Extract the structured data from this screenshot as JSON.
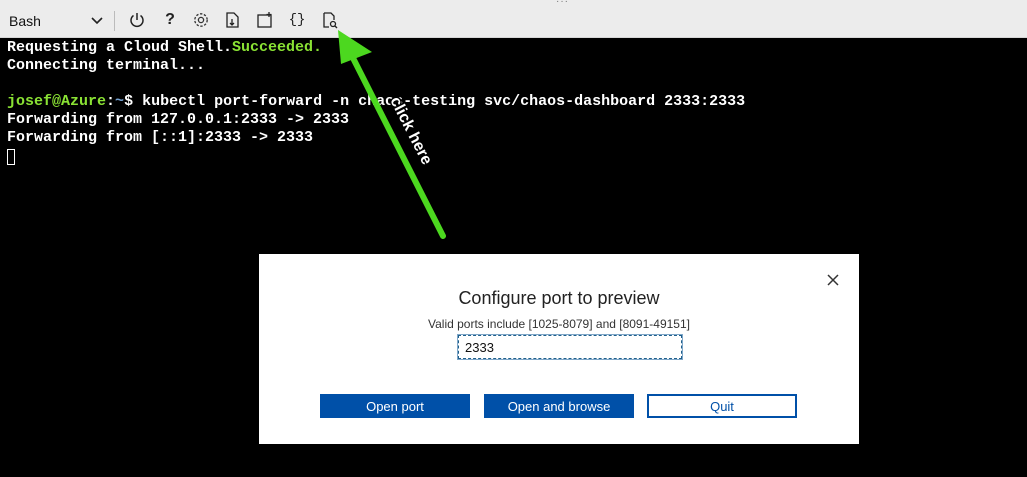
{
  "toolbar": {
    "shell_selector": {
      "value": "Bash"
    },
    "icons": [
      {
        "name": "restart-icon",
        "glyph": "⏻"
      },
      {
        "name": "help-icon",
        "glyph": "?"
      },
      {
        "name": "settings-icon",
        "glyph": "⚙"
      },
      {
        "name": "upload-download-icon",
        "glyph": ""
      },
      {
        "name": "open-new-session-icon",
        "glyph": ""
      },
      {
        "name": "editor-braces-icon",
        "glyph": "{}"
      },
      {
        "name": "web-preview-icon",
        "glyph": ""
      }
    ]
  },
  "terminal": {
    "line1_prefix": "Requesting a Cloud Shell.",
    "line1_status": "Succeeded.",
    "line2": "Connecting terminal...",
    "prompt_user": "josef@Azure",
    "prompt_sep": ":",
    "prompt_path": "~",
    "prompt_char": "$",
    "command": " kubectl port-forward -n chaos-testing svc/chaos-dashboard 2333:2333",
    "line5": "Forwarding from 127.0.0.1:2333 -> 2333",
    "line6": "Forwarding from [::1]:2333 -> 2333"
  },
  "annotation": {
    "text": "click here",
    "color": "#4cd81f"
  },
  "dialog": {
    "title": "Configure port to preview",
    "subtitle": "Valid ports include [1025-8079] and [8091-49151]",
    "port_value": "2333",
    "buttons": {
      "open_port": "Open port",
      "open_and_browse": "Open and browse",
      "quit": "Quit"
    }
  },
  "colors": {
    "primary": "#0050a8",
    "terminal_green": "#8ae234",
    "terminal_blue": "#729fcf"
  }
}
